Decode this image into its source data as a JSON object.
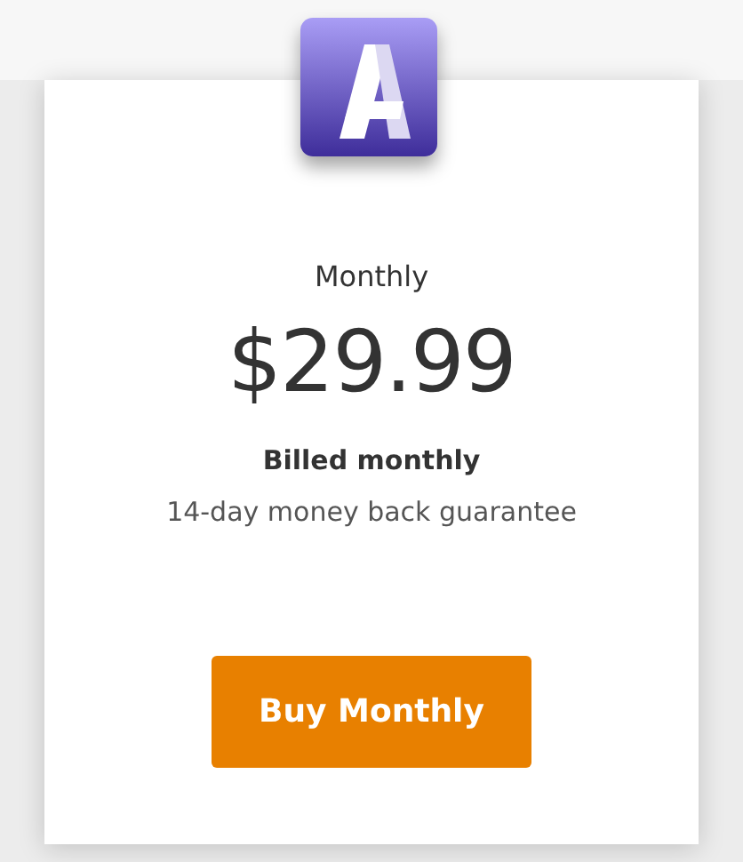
{
  "plan": {
    "name": "Monthly",
    "price": "$29.99",
    "billing": "Billed monthly",
    "guarantee": "14-day money back guarantee"
  },
  "button": {
    "label": "Buy Monthly"
  }
}
